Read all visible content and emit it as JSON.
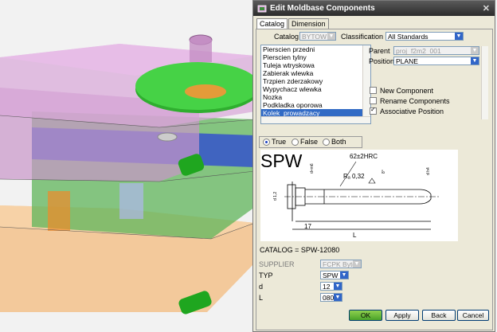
{
  "dialog": {
    "title": "Edit Moldbase Components",
    "tabs": [
      "Catalog",
      "Dimension"
    ],
    "catalog_label": "Catalog",
    "catalog_value": "BYTOW",
    "classification_label": "Classification",
    "classification_value": "All Standards",
    "components": [
      "Pierscien przedni",
      "Pierscien tylny",
      "Tuleja wtryskowa",
      "Zabierak wlewka",
      "Trzpien zderzakowy",
      "Wypychacz wlewka",
      "Nozka",
      "Podkladka oporowa",
      "Kolek_prowadzacy"
    ],
    "parent_label": "Parent",
    "parent_value": "proj_f2m2_001",
    "position_label": "Position",
    "position_value": "PLANE",
    "new_component": "New Component",
    "rename_components": "Rename Components",
    "associative_position": "Associative Position",
    "filter_options": [
      "True",
      "False",
      "Both"
    ],
    "drawing": {
      "code": "SPW",
      "hardness": "62±2HRC",
      "radius": "Rₐ 0,32",
      "length_fixed": "17",
      "length_var": "L",
      "dim_d6": "d+m6",
      "dim_h4": "d h4",
      "dim_d12": "d 1,2",
      "dim_8": "8°"
    },
    "catalog_code": "CATALOG = SPW-12080",
    "supplier_label": "SUPPLIER",
    "supplier_value": "FCPK Bytow",
    "typ_label": "TYP",
    "typ_value": "SPW",
    "d_label": "d",
    "d_value": "12",
    "l_label": "L",
    "l_value": "080",
    "buttons": {
      "ok": "OK",
      "apply": "Apply",
      "back": "Back",
      "cancel": "Cancel"
    }
  }
}
